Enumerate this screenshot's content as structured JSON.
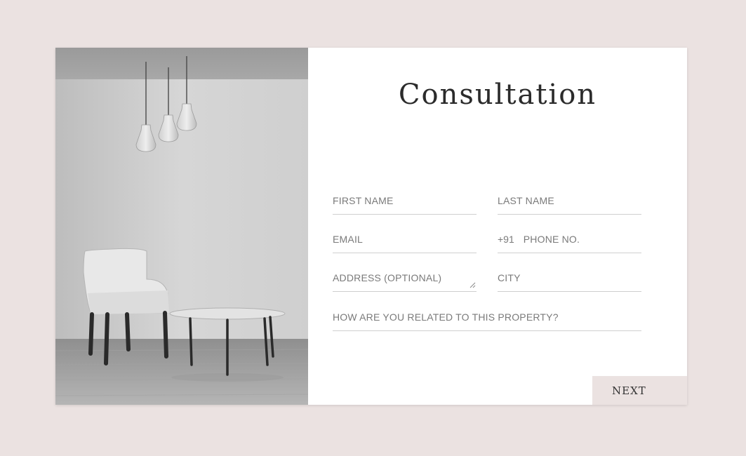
{
  "form": {
    "title": "Consultation",
    "first_name": {
      "placeholder": "FIRST NAME",
      "value": ""
    },
    "last_name": {
      "placeholder": "LAST NAME",
      "value": ""
    },
    "email": {
      "placeholder": "EMAIL",
      "value": ""
    },
    "phone": {
      "prefix": "+91",
      "placeholder": "PHONE NO.",
      "value": ""
    },
    "address": {
      "placeholder": "ADDRESS (OPTIONAL)",
      "value": ""
    },
    "city": {
      "placeholder": "CITY",
      "value": ""
    },
    "relation": {
      "placeholder": "HOW ARE YOU RELATED TO THIS PROPERTY?",
      "value": ""
    },
    "next_label": "NEXT"
  },
  "colors": {
    "page_background": "#ebe2e1",
    "card_background": "#ffffff",
    "button_background": "#ebe2e1",
    "title_text": "#2b2b2b",
    "placeholder_text": "#7a7a7a",
    "underline": "#cfcfcf"
  },
  "image": {
    "semantic": "interior-photo",
    "depicts": [
      "pendant-lamps",
      "armchair",
      "round-coffee-table"
    ]
  }
}
